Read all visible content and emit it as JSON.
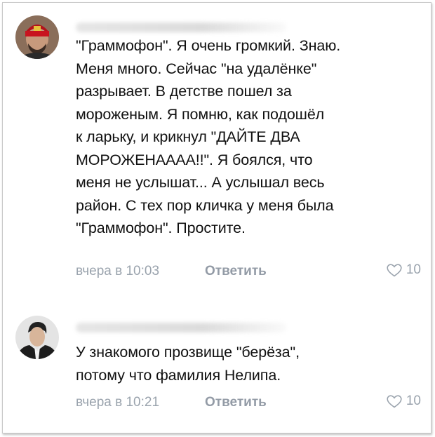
{
  "comments": [
    {
      "text": "\"Граммофон\". Я очень громкий. Знаю.\nМеня много. Сейчас \"на удалёнке\"\nразрывает. В детстве пошел за\nмороженым. Я помню, как подошёл\nк ларьку, и крикнул \"ДАЙТЕ ДВА\nМОРОЖЕНАААА!!\". Я боялся, что\nменя не услышат... А услышал весь\nрайон. С тех пор кличка у меня была\n\"Граммофон\". Простите.",
      "time": "вчера в 10:03",
      "reply_label": "Ответить",
      "likes": "10"
    },
    {
      "text": "У знакомого прозвище \"берёза\",\nпотому что фамилия Нелипа.",
      "time": "вчера в 10:21",
      "reply_label": "Ответить",
      "likes": "10"
    }
  ],
  "icons": {
    "like": "heart-outline-icon"
  },
  "colors": {
    "text": "#111111",
    "meta": "#9aa3ad",
    "background": "#ffffff"
  }
}
